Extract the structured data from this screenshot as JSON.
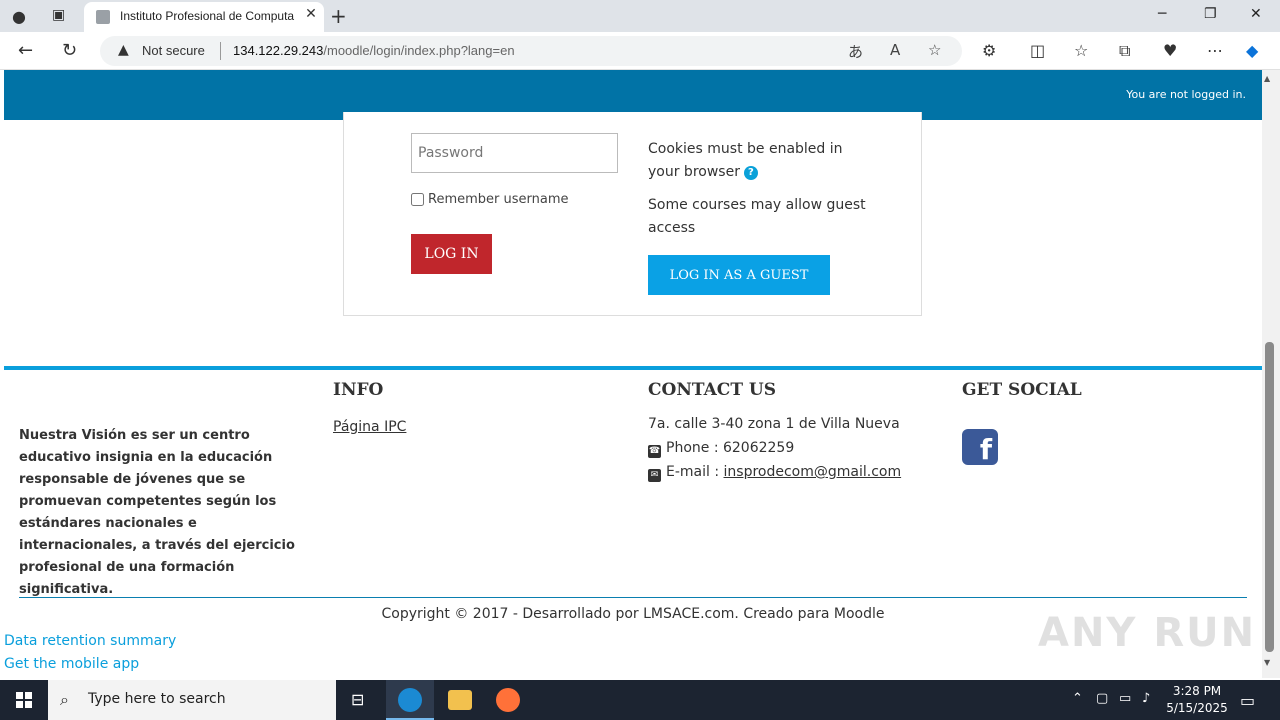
{
  "browser": {
    "tab_title": "Instituto Profesional de Computa",
    "new_tab": "+",
    "not_secure": "Not secure",
    "url_host": "134.122.29.243",
    "url_path": "/moodle/login/index.php?lang=en"
  },
  "header": {
    "login_status": "You are not logged in."
  },
  "login": {
    "password_placeholder": "Password",
    "remember_label": "Remember username",
    "login_button": "LOG IN",
    "cookies_note": "Cookies must be enabled in your browser",
    "guest_note": "Some courses may allow guest access",
    "guest_button": "LOG IN AS A GUEST"
  },
  "footer": {
    "vision": "Nuestra Visión es ser un centro educativo insignia en la educación responsable de jóvenes que se promuevan competentes según los estándares nacionales e internacionales, a través del ejercicio profesional de una formación significativa.",
    "info_heading": "INFO",
    "info_link": "Página IPC",
    "contact_heading": "CONTACT US",
    "address": "7a. calle 3-40 zona 1 de Villa Nueva",
    "phone": "Phone : 62062259",
    "email_label": "E-mail : ",
    "email": "insprodecom@gmail.com",
    "social_heading": "GET SOCIAL",
    "copyright": "Copyright © 2017 - Desarrollado por LMSACE.com. Creado para Moodle",
    "data_retention": "Data retention summary",
    "mobile_app": "Get the mobile app"
  },
  "watermark": "ANY RUN",
  "taskbar": {
    "search_placeholder": "Type here to search",
    "time": "3:28 PM",
    "date": "5/15/2025"
  },
  "colors": {
    "header_blue": "#0173a6",
    "login_red": "#c0262c",
    "guest_blue": "#0aa1e5",
    "accent_line": "#0a9fdc"
  }
}
